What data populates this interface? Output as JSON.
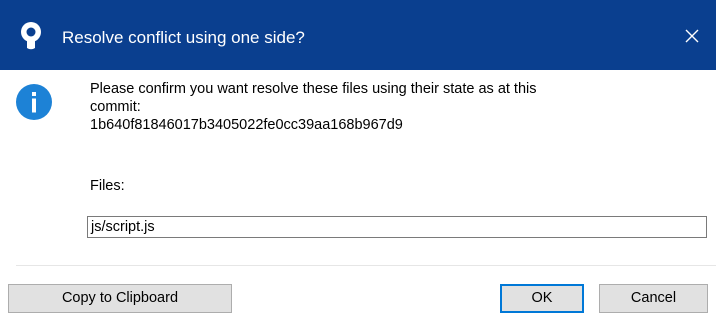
{
  "dialog": {
    "title": "Resolve conflict using one side?",
    "app_icon": "sourcetree-logo-icon",
    "close_icon": "close-icon",
    "info_icon": "info-icon",
    "message_lines": [
      "Please confirm you want resolve these files using their state as at this",
      "commit:",
      "1b640f81846017b3405022fe0cc39aa168b967d9"
    ],
    "files_label": "Files:",
    "files_value": "js/script.js",
    "buttons": {
      "copy": "Copy to Clipboard",
      "ok": "OK",
      "cancel": "Cancel"
    }
  },
  "colors": {
    "titlebar": "#0a3f8f",
    "info_icon": "#1d82d6",
    "button_face": "#e1e1e1",
    "default_button_border": "#0078d7"
  }
}
